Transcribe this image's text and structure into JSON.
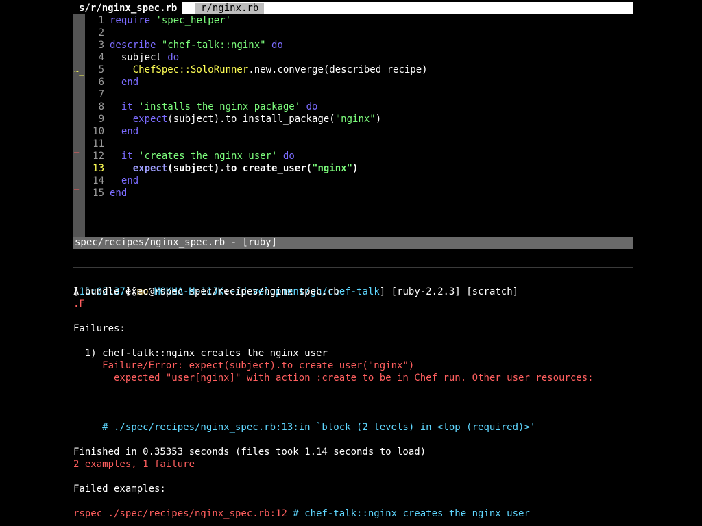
{
  "editor": {
    "tabs": [
      {
        "label": "s/r/nginx_spec.rb",
        "active": true
      },
      {
        "label": "r/nginx.rb",
        "active": false
      }
    ],
    "lines": [
      {
        "n": "1",
        "tokens": [
          [
            "kw",
            "require"
          ],
          [
            "plain",
            " "
          ],
          [
            "str",
            "'spec_helper'"
          ]
        ]
      },
      {
        "n": "2",
        "tokens": []
      },
      {
        "n": "3",
        "tokens": [
          [
            "kw",
            "describe"
          ],
          [
            "plain",
            " "
          ],
          [
            "str",
            "\"chef-talk::nginx\""
          ],
          [
            "plain",
            " "
          ],
          [
            "kw",
            "do"
          ]
        ]
      },
      {
        "n": "4",
        "tokens": [
          [
            "plain",
            "  subject "
          ],
          [
            "kw",
            "do"
          ]
        ]
      },
      {
        "n": "5",
        "tokens": [
          [
            "plain",
            "    "
          ],
          [
            "const",
            "ChefSpec::SoloRunner"
          ],
          [
            "plain",
            ".new.converge(described_recipe)"
          ]
        ]
      },
      {
        "n": "6",
        "tokens": [
          [
            "plain",
            "  "
          ],
          [
            "kw",
            "end"
          ]
        ]
      },
      {
        "n": "7",
        "tokens": []
      },
      {
        "n": "8",
        "tokens": [
          [
            "plain",
            "  "
          ],
          [
            "kw",
            "it"
          ],
          [
            "plain",
            " "
          ],
          [
            "str",
            "'installs the nginx package'"
          ],
          [
            "plain",
            " "
          ],
          [
            "kw",
            "do"
          ]
        ]
      },
      {
        "n": "9",
        "tokens": [
          [
            "plain",
            "    "
          ],
          [
            "kw",
            "expect"
          ],
          [
            "plain",
            "(subject).to install_package("
          ],
          [
            "str",
            "\"nginx\""
          ],
          [
            "plain",
            ")"
          ]
        ]
      },
      {
        "n": "10",
        "tokens": [
          [
            "plain",
            "  "
          ],
          [
            "kw",
            "end"
          ]
        ]
      },
      {
        "n": "11",
        "tokens": []
      },
      {
        "n": "12",
        "tokens": [
          [
            "plain",
            "  "
          ],
          [
            "kw",
            "it"
          ],
          [
            "plain",
            " "
          ],
          [
            "str",
            "'creates the nginx user'"
          ],
          [
            "plain",
            " "
          ],
          [
            "kw",
            "do"
          ]
        ]
      },
      {
        "n": "13",
        "current": true,
        "tokens": [
          [
            "plain",
            "    "
          ],
          [
            "kw",
            "expect"
          ],
          [
            "plain",
            "(subject).to create_user("
          ],
          [
            "str",
            "\"nginx\""
          ],
          [
            "plain",
            ")"
          ]
        ]
      },
      {
        "n": "14",
        "tokens": [
          [
            "plain",
            "  "
          ],
          [
            "kw",
            "end"
          ]
        ]
      },
      {
        "n": "15",
        "tokens": [
          [
            "kw",
            "end"
          ]
        ]
      }
    ],
    "status": "spec/recipes/nginx_spec.rb - [ruby]"
  },
  "terminal": {
    "prompt": {
      "time": "11:02:37",
      "user": "mo",
      "host": "MOKHA-M-11JK",
      "path": "~/development/gh/chef-talk",
      "ruby": "[ruby-2.2.3]",
      "branch": "[scratch]"
    },
    "command": "λ bundle exec rspec spec/recipes/nginx_spec.rb",
    "progress": ".F",
    "failures_header": "Failures:",
    "failure_title": "  1) chef-talk::nginx creates the nginx user",
    "failure_error": "     Failure/Error: expect(subject).to create_user(\"nginx\")",
    "failure_expected": "       expected \"user[nginx]\" with action :create to be in Chef run. Other user resources:",
    "backtrace": "     # ./spec/recipes/nginx_spec.rb:13:in `block (2 levels) in <top (required)>'",
    "finished": "Finished in 0.35353 seconds (files took 1.14 seconds to load)",
    "summary": "2 examples, 1 failure",
    "failed_examples_header": "Failed examples:",
    "rerun_cmd": "rspec ./spec/recipes/nginx_spec.rb:12",
    "rerun_comment": " # chef-talk::nginx creates the nginx user"
  }
}
